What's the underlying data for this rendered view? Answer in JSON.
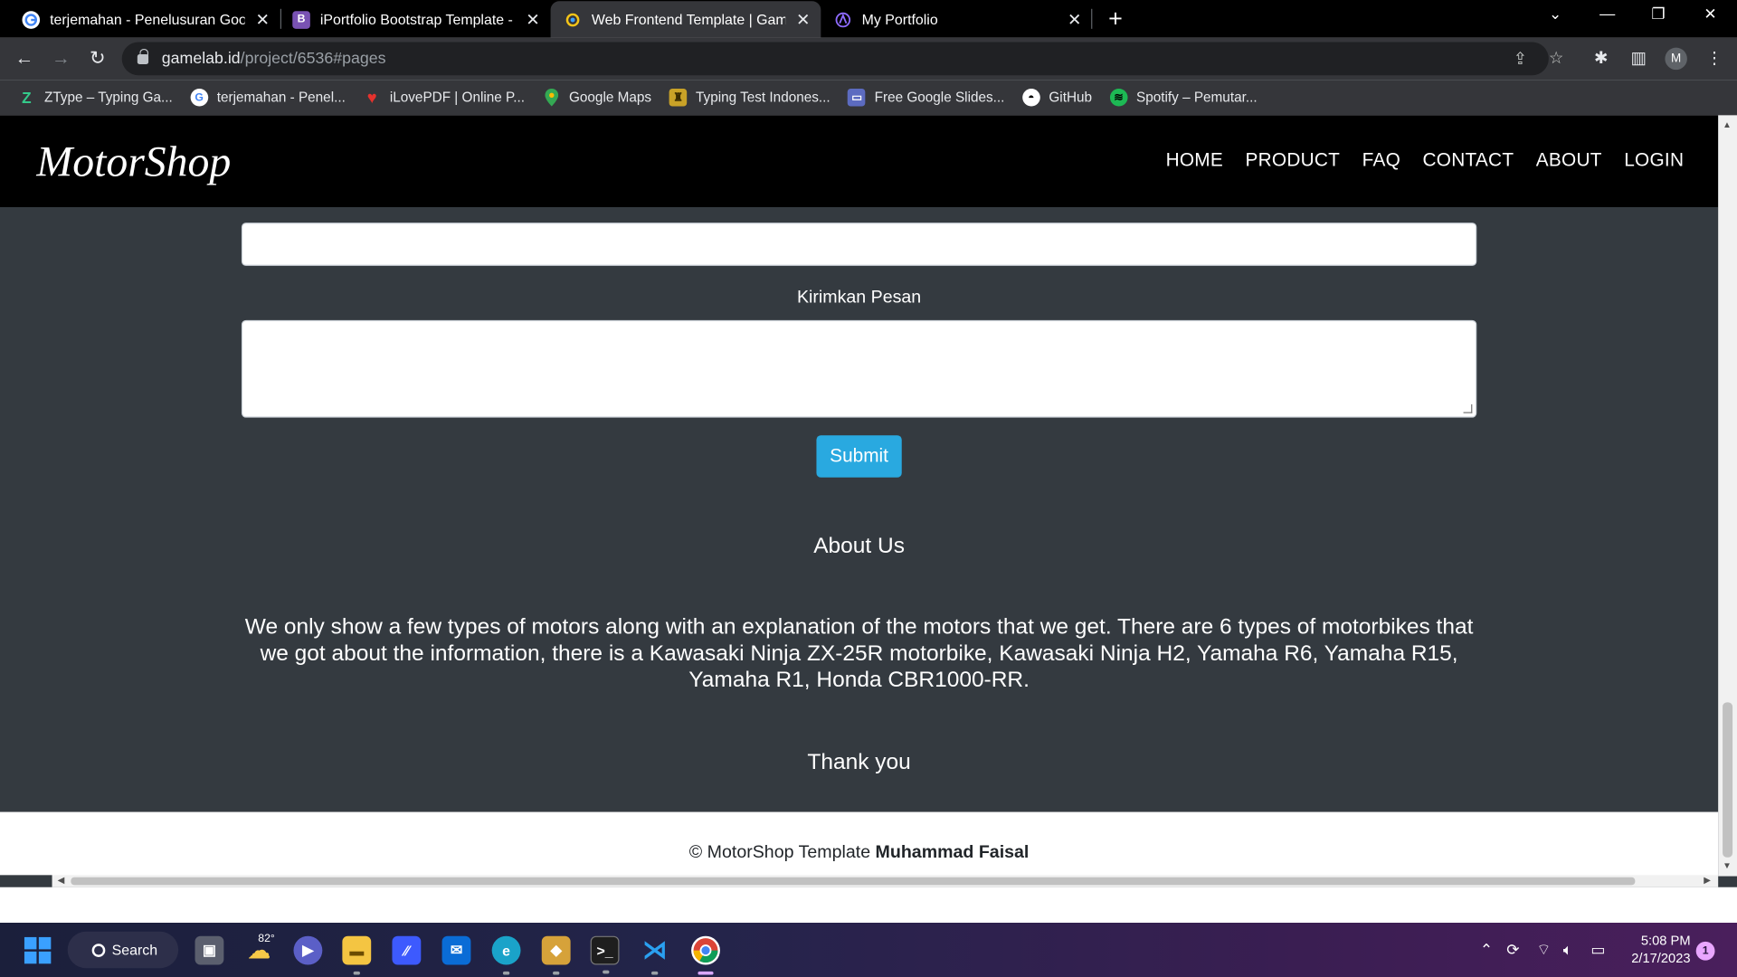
{
  "browser": {
    "tabs": [
      {
        "title": "terjemahan - Penelusuran Googl",
        "favicon": "google-icon"
      },
      {
        "title": "iPortfolio Bootstrap Template - In",
        "favicon": "bootstrap-icon",
        "favicon_text": "B"
      },
      {
        "title": "Web Frontend Template | Gamela",
        "favicon": "gamelab-icon",
        "active": true
      },
      {
        "title": "My Portfolio",
        "favicon": "portfolio-icon"
      }
    ],
    "address": {
      "host": "gamelab.id",
      "path": "/project/6536#pages"
    },
    "profile_initial": "M",
    "bookmarks": [
      {
        "label": "ZType – Typing Ga...",
        "icon": "ztype-icon"
      },
      {
        "label": "terjemahan - Penel...",
        "icon": "google-icon"
      },
      {
        "label": "iLovePDF | Online P...",
        "icon": "ilovepdf-icon"
      },
      {
        "label": "Google Maps",
        "icon": "maps-icon"
      },
      {
        "label": "Typing Test Indones...",
        "icon": "typing-test-icon"
      },
      {
        "label": "Free Google Slides...",
        "icon": "slides-icon"
      },
      {
        "label": "GitHub",
        "icon": "github-icon"
      },
      {
        "label": "Spotify – Pemutar...",
        "icon": "spotify-icon"
      }
    ]
  },
  "site": {
    "brand": "MotorShop",
    "nav": [
      "HOME",
      "PRODUCT",
      "FAQ",
      "CONTACT",
      "ABOUT",
      "LOGIN"
    ],
    "form": {
      "message_label": "Kirimkan Pesan",
      "submit_label": "Submit"
    },
    "about": {
      "title": "About Us",
      "text": "We only show a few types of motors along with an explanation of the motors that we get. There are 6 types of motorbikes that we got about the information, there is a Kawasaki Ninja ZX-25R motorbike, Kawasaki Ninja H2, Yamaha R6, Yamaha R15, Yamaha R1, Honda CBR1000-RR.",
      "thanks": "Thank you"
    },
    "footer": {
      "prefix": "© MotorShop Template ",
      "author": "Muhammad Faisal"
    }
  },
  "taskbar": {
    "search_label": "Search",
    "weather_temp": "82°",
    "time": "5:08 PM",
    "date": "2/17/2023",
    "notifications": "1"
  },
  "colors": {
    "page_bg": "#343a40",
    "nav_bg": "#000000",
    "submit_bg": "#29a9e0"
  }
}
